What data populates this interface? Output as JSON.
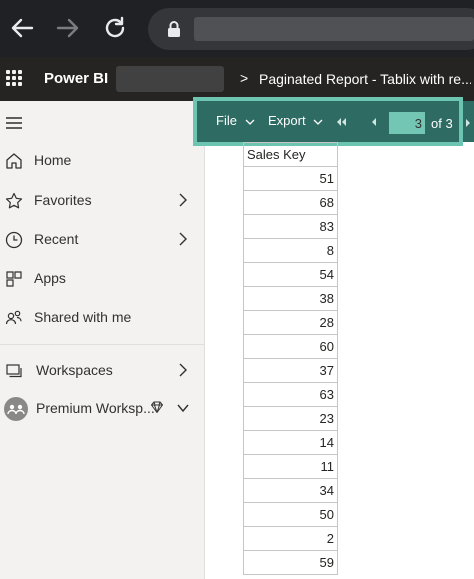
{
  "browser": {
    "icons": [
      "back-arrow-icon",
      "forward-arrow-icon",
      "reload-icon",
      "lock-icon"
    ]
  },
  "header": {
    "brand": "Power BI",
    "breadcrumb_separator": ">",
    "report_title": "Paginated Report - Tablix with re..."
  },
  "sidebar": {
    "items": [
      {
        "label": "Home",
        "icon": "home-icon",
        "has_chevron": false
      },
      {
        "label": "Favorites",
        "icon": "star-icon",
        "has_chevron": true
      },
      {
        "label": "Recent",
        "icon": "clock-icon",
        "has_chevron": true
      },
      {
        "label": "Apps",
        "icon": "apps-icon",
        "has_chevron": false
      },
      {
        "label": "Shared with me",
        "icon": "shared-people-icon",
        "has_chevron": false
      },
      {
        "label": "Workspaces",
        "icon": "workspaces-icon",
        "has_chevron": true
      },
      {
        "label": "Premium Worksp...",
        "icon": "workspace-avatar-icon",
        "has_chevron": true,
        "chevron": "down"
      }
    ]
  },
  "toolbar": {
    "file_label": "File",
    "export_label": "Export",
    "current_page": "3",
    "page_total": "of 3",
    "highlight_color": "#6cc5b0",
    "background_color": "#2e6b62"
  },
  "report": {
    "column_header": "Sales Key",
    "rows": [
      "51",
      "68",
      "83",
      "8",
      "54",
      "38",
      "28",
      "60",
      "37",
      "63",
      "23",
      "14",
      "11",
      "34",
      "50",
      "2",
      "59"
    ]
  }
}
